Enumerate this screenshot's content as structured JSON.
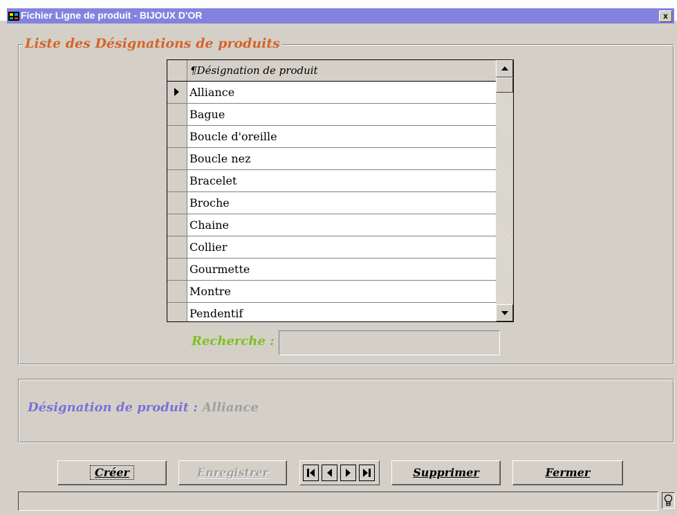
{
  "window": {
    "title": "Fichier Ligne de produit - BIJOUX D'OR",
    "close_label": "x"
  },
  "group": {
    "title": "Liste des Désignations de produits"
  },
  "grid": {
    "header": "¶Désignation de produit",
    "rows": [
      "Alliance",
      "Bague",
      "Boucle d'oreille",
      "Boucle nez",
      "Bracelet",
      "Broche",
      "Chaine",
      "Collier",
      "Gourmette",
      "Montre",
      "Pendentif"
    ],
    "selected_index": 0
  },
  "search": {
    "label": "Recherche :",
    "value": ""
  },
  "detail": {
    "label": "Désignation de produit :",
    "value": "Alliance"
  },
  "buttons": {
    "create": "Créer",
    "save": "Enregistrer",
    "delete": "Supprimer",
    "close": "Fermer"
  },
  "status": {
    "text": ""
  },
  "colors": {
    "title_bar": "#8383df",
    "group_title": "#d5642a",
    "search_label": "#7fbf1e",
    "detail_label": "#7a72d6"
  },
  "icons": {
    "nav": [
      "first-record-icon",
      "previous-record-icon",
      "next-record-icon",
      "last-record-icon"
    ],
    "status": "lightbulb-icon"
  }
}
